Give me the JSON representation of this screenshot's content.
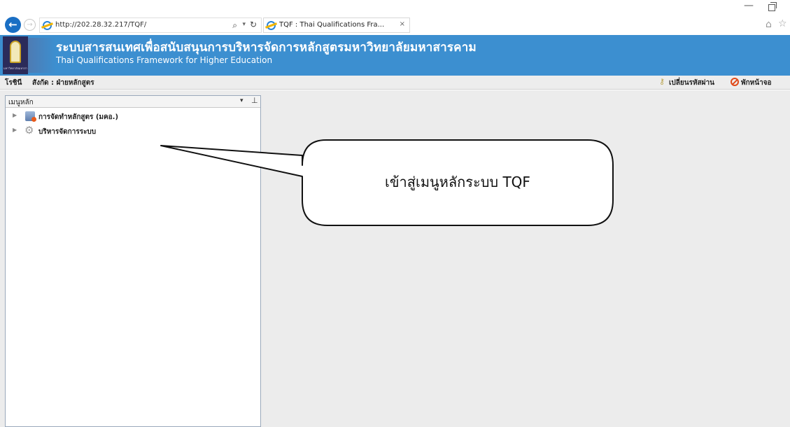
{
  "browser": {
    "url": "http://202.28.32.217/TQF/",
    "tab_label": "TQF : Thai Qualifications Fra...",
    "tab_close": "×",
    "search_glyph": "⌕",
    "dropdown_glyph": "▾",
    "refresh_glyph": "↻"
  },
  "header": {
    "logo_caption": "มหาวิทยาลัยมหาสารคาม",
    "title": "ระบบสารสนเทศเพื่อสนับสนุนการบริหารจัดการหลักสูตรมหาวิทยาลัยมหาสารคาม",
    "subtitle": "Thai Qualifications Framework for Higher Education"
  },
  "status_bar": {
    "user": "โรชินี",
    "department": "สังกัด : ฝ่ายหลักสูตร",
    "change_password": "เปลี่ยนรหัสผ่าน",
    "logout": "พักหน้าจอ"
  },
  "menu": {
    "title": "เมนูหลัก",
    "dropdown_glyph": "▾",
    "pin_glyph": "⊥",
    "items": [
      {
        "label": "การจัดทำหลักสูตร (มคอ.)",
        "icon": "database-icon"
      },
      {
        "label": "บริหารจัดการระบบ",
        "icon": "gear-icon"
      }
    ]
  },
  "callout": {
    "text": "เข้าสู่เมนูหลักระบบ TQF"
  },
  "colors": {
    "header_bg": "#3c8fd0",
    "nav_back": "#1a6fc4",
    "content_bg": "#ececec",
    "logout_icon": "#e04a1a"
  }
}
